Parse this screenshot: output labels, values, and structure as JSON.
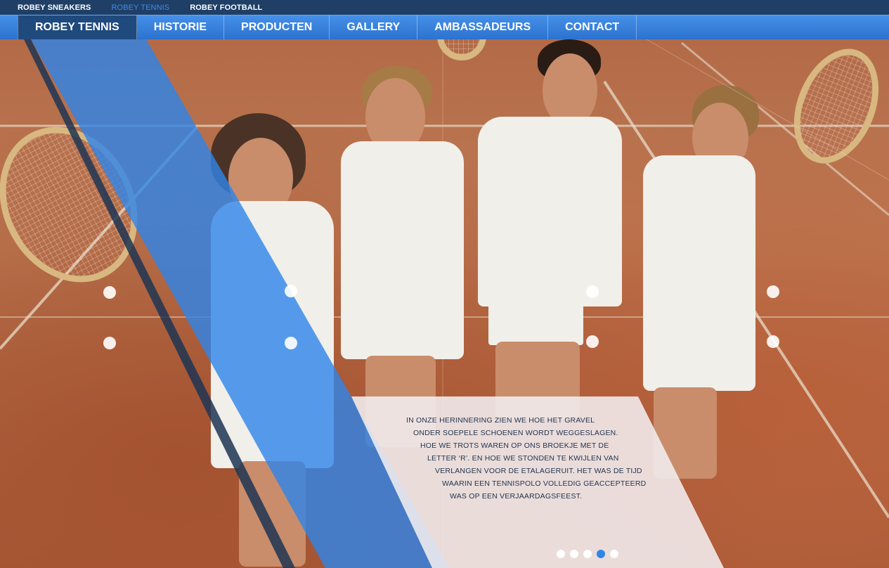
{
  "topbar": {
    "links": [
      "ROBEY SNEAKERS",
      "ROBEY TENNIS",
      "ROBEY FOOTBALL"
    ],
    "active_index": 1
  },
  "nav": {
    "items": [
      "ROBEY TENNIS",
      "HISTORIE",
      "PRODUCTEN",
      "GALLERY",
      "AMBASSADEURS",
      "CONTACT"
    ],
    "active_index": 0
  },
  "hero": {
    "story_lines": [
      "IN ONZE HERINNERING ZIEN WE HOE HET GRAVEL",
      "ONDER SOEPELE SCHOENEN WORDT WEGGESLAGEN.",
      "HOE WE TROTS WAREN OP ONS BROEKJE MET DE",
      "LETTER ‘R’. EN HOE WE STONDEN TE KWIJLEN VAN",
      "VERLANGEN VOOR DE ETALAGERUIT. HET WAS DE TIJD",
      "WAARIN EEN TENNISPOLO VOLLEDIG GEACCEPTEERD",
      "WAS OP EEN VERJAARDAGSFEEST."
    ],
    "slides_total": 5,
    "active_slide": 4
  },
  "colors": {
    "topbar": "#1f3f66",
    "nav": "#3b86e3",
    "accent_blue": "#2f86e8",
    "clay": "#b86a45"
  }
}
